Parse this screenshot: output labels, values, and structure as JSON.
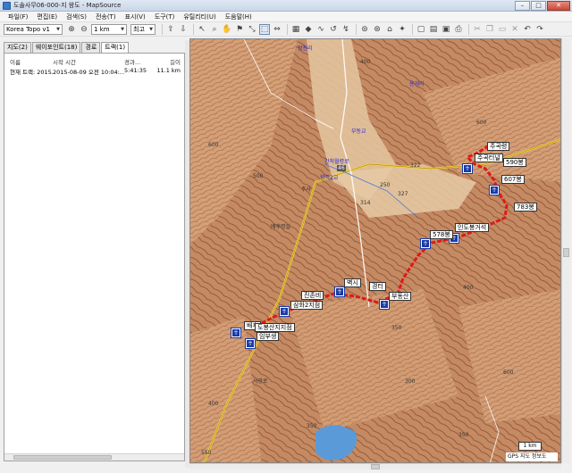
{
  "window": {
    "title": "도솔사무06-000-지 왕도 - MapSource",
    "minimize": "–",
    "maximize": "□",
    "close": "✕"
  },
  "menu": [
    "파일(F)",
    "편집(E)",
    "검색(S)",
    "전송(T)",
    "표시(V)",
    "도구(T)",
    "유틸리티(U)",
    "도움말(H)"
  ],
  "toolbar": {
    "map_product": "Korea Topo v1",
    "zoom_scale": "1 km",
    "detail_level": "최고"
  },
  "tabs": [
    "지도(2)",
    "웨이포인트(18)",
    "경로",
    "트랙(1)"
  ],
  "active_tab": 3,
  "track_list": {
    "columns": [
      "이름",
      "시작 시간",
      "경과...",
      "길이"
    ],
    "rows": [
      [
        "현재 트랙: 2015...",
        "2015-08-09 오전 10:04:...",
        "5:41:35",
        "11.1 km"
      ]
    ]
  },
  "map": {
    "waypoints": [
      "주곡령",
      "주곡터널",
      "590봉",
      "607봉",
      "783봉",
      "인도봉거석",
      "578봉",
      "벽시",
      "경터",
      "부동산",
      "진존비",
      "삼화2지점",
      "배후",
      "도봉산지지점",
      "임부생"
    ],
    "place_labels": [
      "왕천리",
      "간척월령로",
      "주사",
      "배후령길",
      "부동교",
      "용개리",
      "향적2교",
      "사망로"
    ],
    "spot_heights": [
      "400",
      "600",
      "500",
      "250",
      "322",
      "314",
      "327",
      "400",
      "350",
      "300",
      "600",
      "600",
      "400",
      "350",
      "350",
      "550"
    ],
    "road_number": "46",
    "track_color": "#e01818",
    "scale_label": "1 km",
    "status_text": "GPS 지도 정보도"
  }
}
